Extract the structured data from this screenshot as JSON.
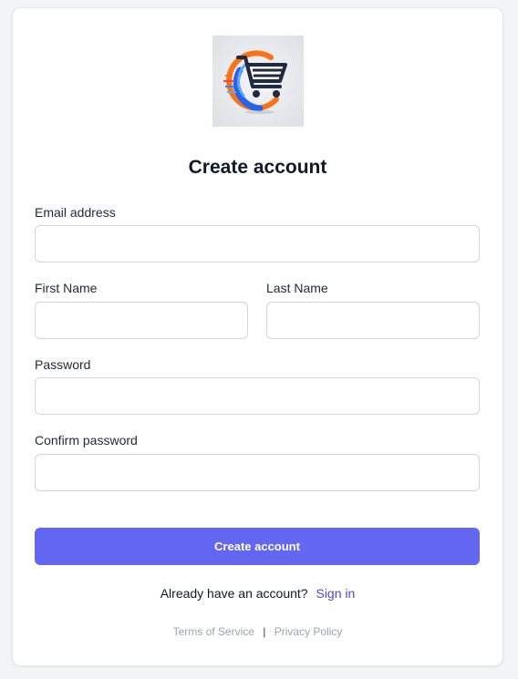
{
  "form": {
    "title": "Create account",
    "email_label": "Email address",
    "email_value": "",
    "first_name_label": "First Name",
    "first_name_value": "",
    "last_name_label": "Last Name",
    "last_name_value": "",
    "password_label": "Password",
    "password_value": "",
    "confirm_password_label": "Confirm password",
    "confirm_password_value": "",
    "submit_label": "Create account"
  },
  "signin": {
    "prompt": "Already have an account?",
    "link_label": "Sign in"
  },
  "footer": {
    "terms_label": "Terms of Service",
    "separator": "|",
    "privacy_label": "Privacy Policy"
  },
  "colors": {
    "accent": "#6366f1",
    "link": "#4f46e5",
    "logo_orange": "#f97316",
    "logo_blue": "#2563eb",
    "logo_dark": "#1f2a44"
  },
  "icons": {
    "logo": "shopping-cart-icon"
  }
}
